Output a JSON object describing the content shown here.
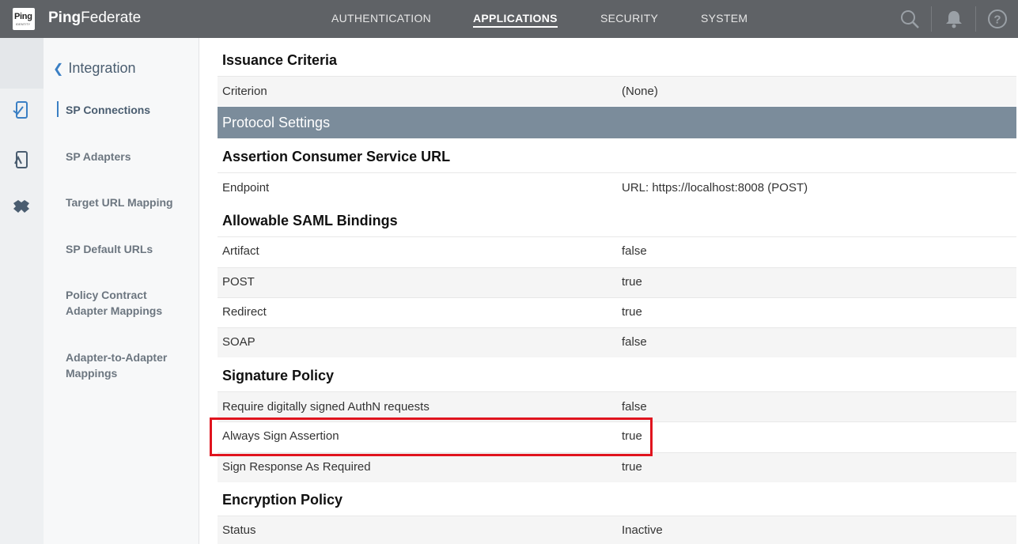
{
  "app": {
    "logo_text": "Ping",
    "logo_sub": "IDENTITY",
    "brand_bold": "Ping",
    "brand_rest": "Federate"
  },
  "topnav": {
    "items": [
      "AUTHENTICATION",
      "APPLICATIONS",
      "SECURITY",
      "SYSTEM"
    ],
    "active": "APPLICATIONS"
  },
  "subnav": {
    "back_label": "Integration",
    "items": [
      "SP Connections",
      "SP Adapters",
      "Target URL Mapping",
      "SP Default URLs",
      "Policy Contract Adapter Mappings",
      "Adapter-to-Adapter Mappings"
    ],
    "active": "SP Connections"
  },
  "content": {
    "issuance_title": "Issuance Criteria",
    "criterion": {
      "key": "Criterion",
      "value": "(None)"
    },
    "protocol_title": "Protocol Settings",
    "acs_title": "Assertion Consumer Service URL",
    "endpoint": {
      "key": "Endpoint",
      "value": "URL: https://localhost:8008 (POST)"
    },
    "bindings_title": "Allowable SAML Bindings",
    "bindings": [
      {
        "key": "Artifact",
        "value": "false"
      },
      {
        "key": "POST",
        "value": "true"
      },
      {
        "key": "Redirect",
        "value": "true"
      },
      {
        "key": "SOAP",
        "value": "false"
      }
    ],
    "signature_title": "Signature Policy",
    "signature": [
      {
        "key": "Require digitally signed AuthN requests",
        "value": "false"
      },
      {
        "key": "Always Sign Assertion",
        "value": "true"
      },
      {
        "key": "Sign Response As Required",
        "value": "true"
      }
    ],
    "encryption_title": "Encryption Policy",
    "encryption_status": {
      "key": "Status",
      "value": "Inactive"
    }
  },
  "colors": {
    "topbar": "#5f6266",
    "protocol_header": "#7b8c9b",
    "accent": "#3a7fc4",
    "highlight": "#e0141e"
  },
  "icons": [
    "search-icon",
    "bell-icon",
    "help-icon",
    "applications-icon",
    "sp-connections-icon",
    "integration-icon"
  ]
}
